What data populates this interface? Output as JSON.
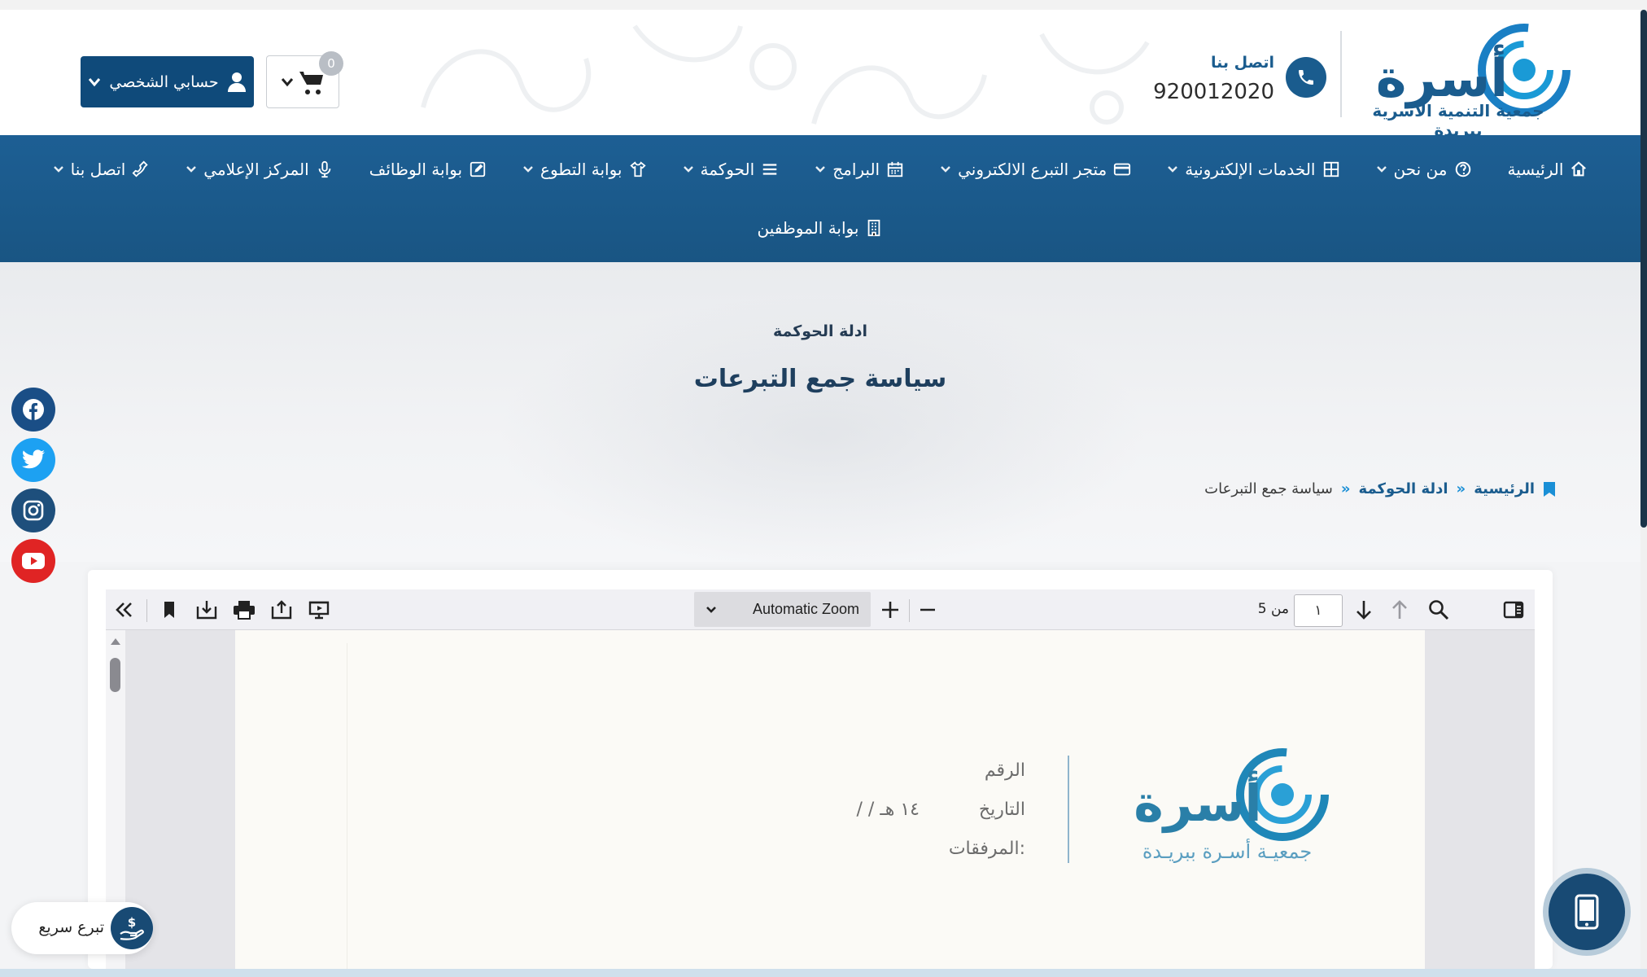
{
  "header": {
    "logo_wordmark": "أسرة",
    "logo_subtitle": "جمعية التنمية الأسرية ببريدة",
    "contact_label": "اتصل بنا",
    "contact_number": "920012020",
    "account_label": "حسابي الشخصي",
    "cart_count": "0",
    "colors": {
      "brand": "#1a5c8e",
      "account_button": "#0f4a7a"
    }
  },
  "nav": {
    "row1": [
      {
        "label": "الرئيسية",
        "icon": "home-icon",
        "dropdown": false
      },
      {
        "label": "من نحن",
        "icon": "question-icon",
        "dropdown": true
      },
      {
        "label": "الخدمات الإلكترونية",
        "icon": "grid-icon",
        "dropdown": true
      },
      {
        "label": "متجر التبرع الالكتروني",
        "icon": "credit-card-icon",
        "dropdown": true
      },
      {
        "label": "البرامج",
        "icon": "calendar-icon",
        "dropdown": true
      },
      {
        "label": "الحوكمة",
        "icon": "list-icon",
        "dropdown": true
      },
      {
        "label": "بوابة التطوع",
        "icon": "shirt-icon",
        "dropdown": true
      },
      {
        "label": "بوابة الوظائف",
        "icon": "edit-icon",
        "dropdown": false
      },
      {
        "label": "المركز الإعلامي",
        "icon": "microphone-icon",
        "dropdown": true
      },
      {
        "label": "اتصل بنا",
        "icon": "phone-icon",
        "dropdown": true
      }
    ],
    "row2": [
      {
        "label": "بوابة الموظفين",
        "icon": "building-icon",
        "dropdown": false
      }
    ]
  },
  "hero": {
    "subtitle": "ادلة الحوكمة",
    "title": "سياسة جمع التبرعات"
  },
  "breadcrumb": {
    "home": "الرئيسية",
    "separator": "»",
    "section": "ادلة الحوكمة",
    "current": "سياسة جمع التبرعات"
  },
  "social": [
    "facebook-icon",
    "twitter-icon",
    "instagram-icon",
    "youtube-icon"
  ],
  "pdf_viewer": {
    "zoom_label": "Automatic Zoom",
    "page_number": "١",
    "page_of": "من 5",
    "document": {
      "field_number": "الرقم",
      "field_date": "التاريخ",
      "date_value": "/      /      ١٤ هـ",
      "field_attachments": "المرفقات:",
      "logo_wordmark": "أسرة",
      "logo_subtitle": "جمعيـة أسـرة ببريـدة"
    }
  },
  "floating": {
    "quick_donate_label": "تبرع سريع"
  }
}
